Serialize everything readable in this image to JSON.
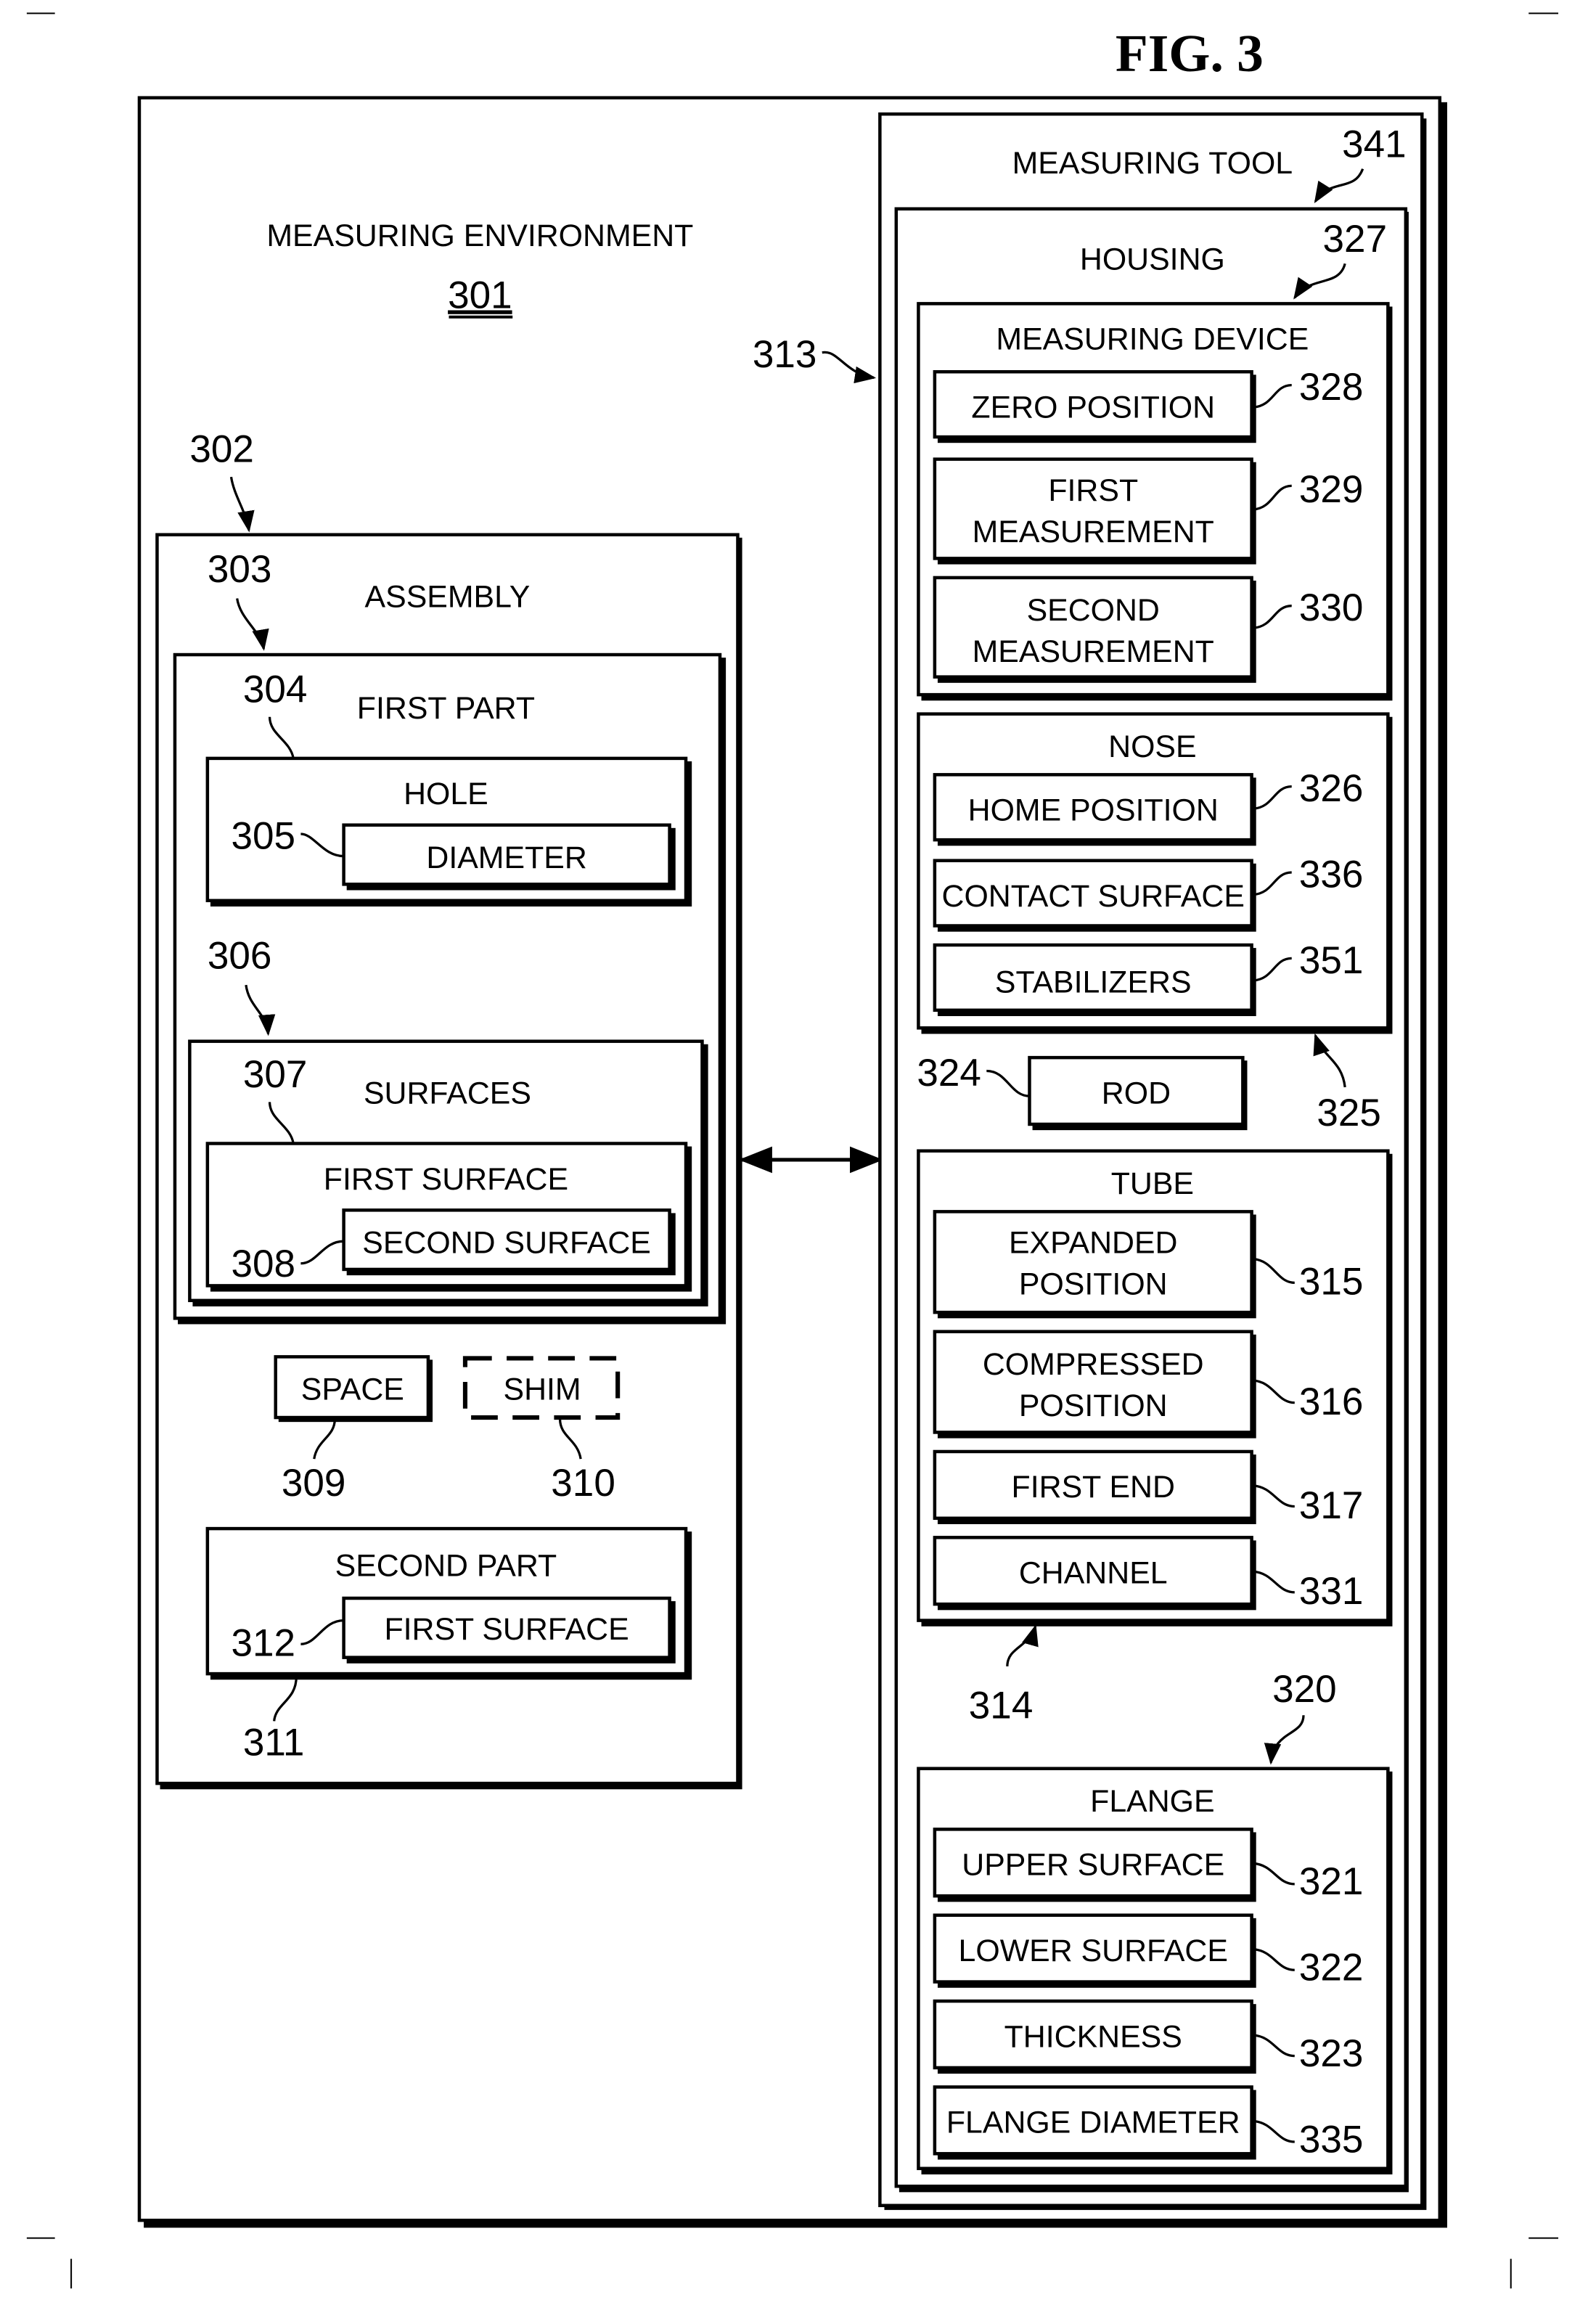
{
  "figure_title": "FIG. 3",
  "environment": {
    "label": "MEASURING ENVIRONMENT",
    "ref": "301"
  },
  "assembly": {
    "label": "ASSEMBLY",
    "ref_outer": "302",
    "ref_inner": "303",
    "first_part": {
      "label": "FIRST PART",
      "ref": "304",
      "hole": {
        "label": "HOLE",
        "diameter_label": "DIAMETER",
        "diameter_ref": "305"
      },
      "surfaces": {
        "label": "SURFACES",
        "ref": "306",
        "inner_ref": "307",
        "first_surface_label": "FIRST SURFACE",
        "second_surface_label": "SECOND SURFACE",
        "second_surface_ref": "308"
      }
    },
    "space": {
      "label": "SPACE",
      "ref": "309"
    },
    "shim": {
      "label": "SHIM",
      "ref": "310"
    },
    "second_part": {
      "label": "SECOND PART",
      "ref": "311",
      "first_surface_label": "FIRST SURFACE",
      "first_surface_ref": "312"
    }
  },
  "connection_ref": "313",
  "measuring_tool": {
    "label": "MEASURING TOOL",
    "ref": "341",
    "housing": {
      "label": "HOUSING",
      "ref": "327",
      "measuring_device": {
        "label": "MEASURING DEVICE",
        "items": [
          {
            "line1": "ZERO POSITION",
            "line2": "",
            "ref": "328"
          },
          {
            "line1": "FIRST",
            "line2": "MEASUREMENT",
            "ref": "329"
          },
          {
            "line1": "SECOND",
            "line2": "MEASUREMENT",
            "ref": "330"
          }
        ]
      },
      "nose": {
        "label": "NOSE",
        "ref": "325",
        "items": [
          {
            "label": "HOME POSITION",
            "ref": "326"
          },
          {
            "label": "CONTACT SURFACE",
            "ref": "336"
          },
          {
            "label": "STABILIZERS",
            "ref": "351"
          }
        ]
      },
      "rod": {
        "label": "ROD",
        "ref": "324"
      },
      "tube": {
        "label": "TUBE",
        "ref": "314",
        "items": [
          {
            "line1": "EXPANDED",
            "line2": "POSITION",
            "ref": "315"
          },
          {
            "line1": "COMPRESSED",
            "line2": "POSITION",
            "ref": "316"
          },
          {
            "line1": "FIRST END",
            "line2": "",
            "ref": "317"
          },
          {
            "line1": "CHANNEL",
            "line2": "",
            "ref": "331"
          }
        ]
      },
      "flange": {
        "label": "FLANGE",
        "ref": "320",
        "items": [
          {
            "label": "UPPER SURFACE",
            "ref": "321"
          },
          {
            "label": "LOWER SURFACE",
            "ref": "322"
          },
          {
            "label": "THICKNESS",
            "ref": "323"
          },
          {
            "label": "FLANGE DIAMETER",
            "ref": "335"
          }
        ]
      }
    }
  }
}
